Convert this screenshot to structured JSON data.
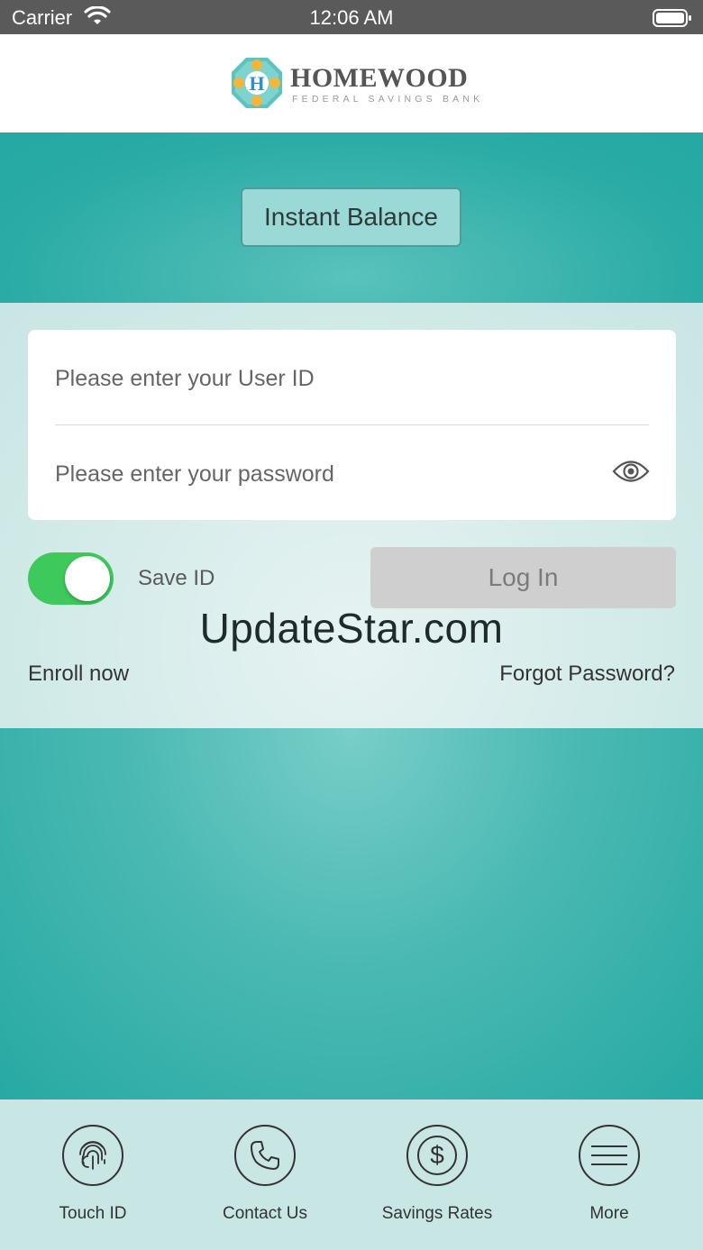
{
  "status_bar": {
    "carrier": "Carrier",
    "time": "12:06 AM"
  },
  "header": {
    "brand_name": "HOMEWOOD",
    "brand_sub": "FEDERAL SAVINGS BANK"
  },
  "instant_balance": {
    "label": "Instant Balance"
  },
  "login": {
    "user_placeholder": "Please enter your User ID",
    "password_placeholder": "Please enter your password",
    "save_id_label": "Save ID",
    "save_id_on": true,
    "login_label": "Log In",
    "enroll_label": "Enroll now",
    "forgot_label": "Forgot Password?"
  },
  "watermark": "UpdateStar.com",
  "tabs": [
    {
      "label": "Touch ID",
      "icon": "fingerprint-icon"
    },
    {
      "label": "Contact Us",
      "icon": "phone-icon"
    },
    {
      "label": "Savings Rates",
      "icon": "dollar-icon"
    },
    {
      "label": "More",
      "icon": "menu-icon"
    }
  ],
  "colors": {
    "teal": "#2aaba5",
    "toggle_on": "#3ec95c",
    "tab_bar": "#c7e6e4"
  }
}
